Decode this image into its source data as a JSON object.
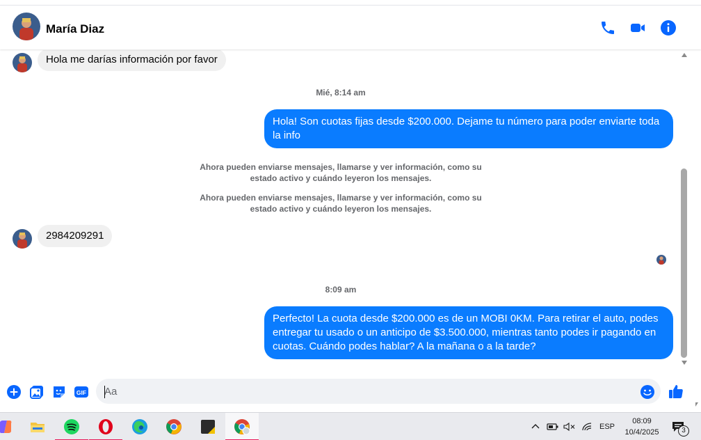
{
  "header": {
    "contact_name": "María Diaz",
    "icons": [
      "phone-icon",
      "video-camera-icon",
      "info-icon"
    ]
  },
  "conversation": {
    "messages": [
      {
        "direction": "in",
        "text": "Hola me darías información por favor"
      },
      {
        "type": "timestamp",
        "text": "Mié, 8:14 am"
      },
      {
        "direction": "out",
        "text": "Hola! Son cuotas fijas desde $200.000. Dejame tu número para poder enviarte toda la info"
      },
      {
        "type": "system",
        "text": "Ahora pueden enviarse mensajes, llamarse y ver información, como su estado activo y cuándo leyeron los mensajes."
      },
      {
        "type": "system",
        "text": "Ahora pueden enviarse mensajes, llamarse y ver información, como su estado activo y cuándo leyeron los mensajes."
      },
      {
        "direction": "in",
        "text": "2984209291"
      },
      {
        "type": "timestamp",
        "text": "8:09 am"
      },
      {
        "direction": "out",
        "text": "Perfecto! La cuota desde $200.000 es de un MOBI 0KM. Para retirar el auto, podes entregar tu usado o un anticipo de $3.500.000, mientras tanto podes ir pagando en cuotas. Cuándo podes hablar? A la mañana o a la tarde?"
      }
    ]
  },
  "composer": {
    "placeholder": "Aa",
    "icons": [
      "plus-icon",
      "photo-icon",
      "sticker-icon",
      "gif-icon",
      "emoji-icon",
      "thumbs-up-icon"
    ],
    "gif_label": "GIF"
  },
  "taskbar": {
    "apps": [
      "copilot-icon",
      "file-explorer-icon",
      "spotify-icon",
      "opera-icon",
      "edge-icon",
      "chrome-icon",
      "sticky-notes-icon",
      "chrome-profile-icon"
    ],
    "language": "ESP",
    "time": "08:09",
    "date": "10/4/2025",
    "notification_count": "3"
  },
  "colors": {
    "accent": "#0a7cff",
    "incoming_bubble": "#f0f0f0",
    "icon_blue": "#0866ff"
  }
}
